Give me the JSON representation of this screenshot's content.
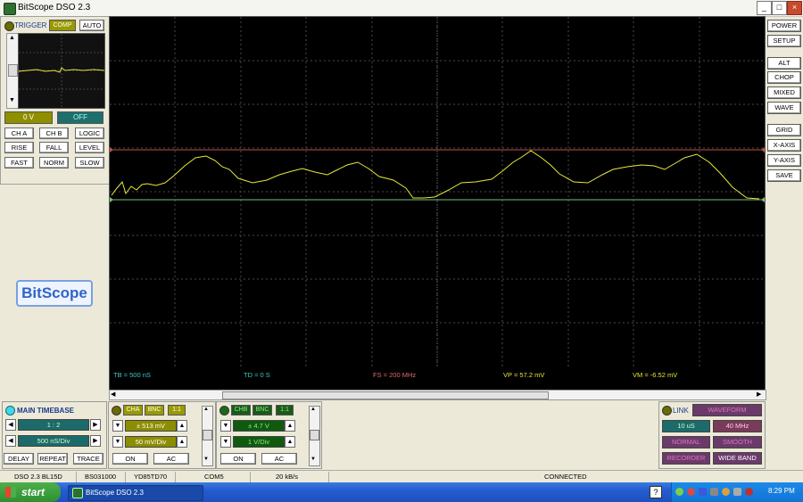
{
  "window": {
    "title": "BitScope DSO 2.3",
    "minimize": "_",
    "maximize": "□",
    "close": "×"
  },
  "trigger": {
    "label": "TRIGGER",
    "comp": "COMP",
    "auto": "AUTO",
    "level_value": "0 V",
    "state": "OFF",
    "buttons": [
      "CH A",
      "CH B",
      "LOGIC",
      "RISE",
      "FALL",
      "LEVEL",
      "FAST",
      "NORM",
      "SLOW"
    ]
  },
  "logo": "BitScope",
  "right_buttons": [
    "POWER",
    "SETUP",
    "ALT",
    "CHOP",
    "MIXED",
    "WAVE",
    "GRID",
    "X-AXIS",
    "Y-AXIS",
    "SAVE"
  ],
  "scope_readout": {
    "tb": "TB = 500 nS",
    "td": "TD = 0 S",
    "fs": "FS = 200 MHz",
    "vp": "VP = 57.2 mV",
    "vm": "VM = -6.52 mV"
  },
  "colors": {
    "trace": "#e8e83a",
    "trigger_line": "#c0504d",
    "ground_line": "#7ac07a",
    "grid": "#4a4a4a",
    "tb_text": "#3fc8c8",
    "fs_text": "#e06a6a",
    "vp_text": "#e8e83a"
  },
  "timebase": {
    "title": "MAIN TIMEBASE",
    "ratio": "1 : 2",
    "rate": "500 nS/Div",
    "delay": "DELAY",
    "repeat": "REPEAT",
    "trace": "TRACE"
  },
  "cha": {
    "tag": "CHA",
    "bnc": "BNC",
    "probe": "1:1",
    "offset": "± 513 mV",
    "scale": "50 mV/Div",
    "on": "ON",
    "coupling": "AC"
  },
  "chb": {
    "tag": "CHB",
    "bnc": "BNC",
    "probe": "1:1",
    "offset": "± 4.7 V",
    "scale": "1 V/Div",
    "on": "ON",
    "coupling": "AC"
  },
  "link": {
    "label": "LINK",
    "waveform": "WAVEFORM",
    "period": "10 uS",
    "freq": "40 MHz",
    "normal": "NORMAL",
    "smooth": "SMOOTH",
    "recorder": "RECORDER",
    "wideband": "WIDE BAND"
  },
  "status": {
    "version": "DSO 2.3 BL15D",
    "serial": "BS031000",
    "id": "YD85TD70",
    "port": "COM5",
    "rate": "20 kB/s",
    "state": "CONNECTED"
  },
  "taskbar": {
    "start": "start",
    "task": "BitScope DSO 2.3",
    "help": "?",
    "clock": "8:29 PM"
  }
}
